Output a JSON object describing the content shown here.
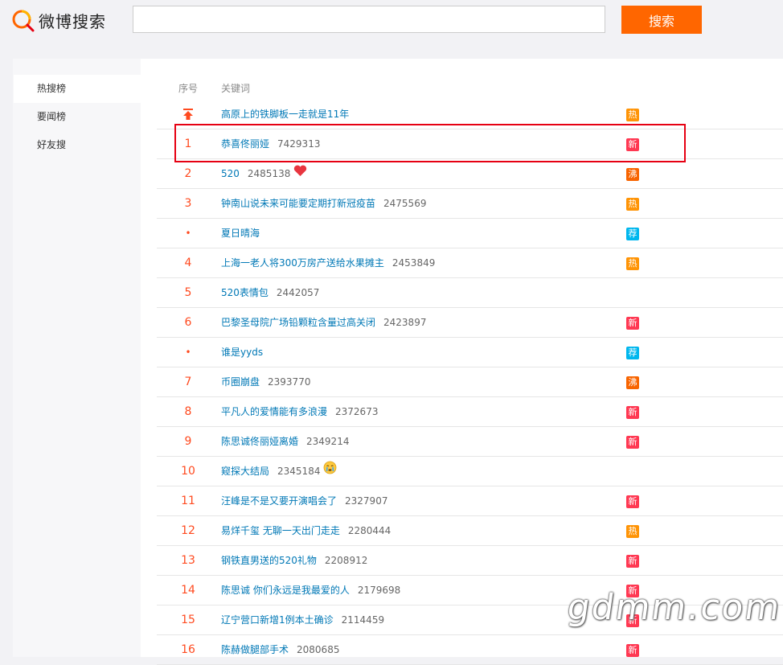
{
  "header": {
    "logo_text": "微博搜索",
    "search_placeholder": "",
    "search_button": "搜索"
  },
  "sidebar": {
    "items": [
      {
        "label": "热搜榜",
        "active": true
      },
      {
        "label": "要闻榜",
        "active": false
      },
      {
        "label": "好友搜",
        "active": false
      }
    ]
  },
  "table": {
    "col_rank": "序号",
    "col_keyword": "关键词",
    "rows": [
      {
        "rank": "",
        "rank_type": "top",
        "keyword": "高原上的铁脚板一走就是11年",
        "count": "",
        "emoji": "",
        "tag": "热",
        "tag_color": "#ff9406"
      },
      {
        "rank": "1",
        "rank_type": "num",
        "keyword": "恭喜佟丽娅",
        "count": "7429313",
        "emoji": "",
        "tag": "新",
        "tag_color": "#ff3852"
      },
      {
        "rank": "2",
        "rank_type": "num",
        "keyword": "520",
        "count": "2485138",
        "emoji": "heart",
        "tag": "沸",
        "tag_color": "#f86400"
      },
      {
        "rank": "3",
        "rank_type": "num",
        "keyword": "钟南山说未来可能要定期打新冠疫苗",
        "count": "2475569",
        "emoji": "",
        "tag": "热",
        "tag_color": "#ff9406"
      },
      {
        "rank": "•",
        "rank_type": "dot",
        "keyword": "夏日晴海",
        "count": "",
        "emoji": "",
        "tag": "荐",
        "tag_color": "#00b7ee"
      },
      {
        "rank": "4",
        "rank_type": "num",
        "keyword": "上海一老人将300万房产送给水果摊主",
        "count": "2453849",
        "emoji": "",
        "tag": "热",
        "tag_color": "#ff9406"
      },
      {
        "rank": "5",
        "rank_type": "num",
        "keyword": "520表情包",
        "count": "2442057",
        "emoji": "",
        "tag": "",
        "tag_color": ""
      },
      {
        "rank": "6",
        "rank_type": "num",
        "keyword": "巴黎圣母院广场铅颗粒含量过高关闭",
        "count": "2423897",
        "emoji": "",
        "tag": "新",
        "tag_color": "#ff3852"
      },
      {
        "rank": "•",
        "rank_type": "dot",
        "keyword": "谁是yyds",
        "count": "",
        "emoji": "",
        "tag": "荐",
        "tag_color": "#00b7ee"
      },
      {
        "rank": "7",
        "rank_type": "num",
        "keyword": "币圈崩盘",
        "count": "2393770",
        "emoji": "",
        "tag": "沸",
        "tag_color": "#f86400"
      },
      {
        "rank": "8",
        "rank_type": "num",
        "keyword": "平凡人的爱情能有多浪漫",
        "count": "2372673",
        "emoji": "",
        "tag": "新",
        "tag_color": "#ff3852"
      },
      {
        "rank": "9",
        "rank_type": "num",
        "keyword": "陈思诚佟丽娅离婚",
        "count": "2349214",
        "emoji": "",
        "tag": "新",
        "tag_color": "#ff3852"
      },
      {
        "rank": "10",
        "rank_type": "num",
        "keyword": "窥探大结局",
        "count": "2345184",
        "emoji": "cry",
        "tag": "",
        "tag_color": ""
      },
      {
        "rank": "11",
        "rank_type": "num",
        "keyword": "汪峰是不是又要开演唱会了",
        "count": "2327907",
        "emoji": "",
        "tag": "新",
        "tag_color": "#ff3852"
      },
      {
        "rank": "12",
        "rank_type": "num",
        "keyword": "易烊千玺 无聊一天出门走走",
        "count": "2280444",
        "emoji": "",
        "tag": "热",
        "tag_color": "#ff9406"
      },
      {
        "rank": "13",
        "rank_type": "num",
        "keyword": "钢铁直男送的520礼物",
        "count": "2208912",
        "emoji": "",
        "tag": "新",
        "tag_color": "#ff3852"
      },
      {
        "rank": "14",
        "rank_type": "num",
        "keyword": "陈思诚 你们永远是我最爱的人",
        "count": "2179698",
        "emoji": "",
        "tag": "新",
        "tag_color": "#ff3852"
      },
      {
        "rank": "15",
        "rank_type": "num",
        "keyword": "辽宁营口新增1例本土确诊",
        "count": "2114459",
        "emoji": "",
        "tag": "新",
        "tag_color": "#ff3852"
      },
      {
        "rank": "16",
        "rank_type": "num",
        "keyword": "陈赫做腿部手术",
        "count": "2080685",
        "emoji": "",
        "tag": "新",
        "tag_color": "#ff3852"
      }
    ]
  },
  "watermark": "gdmm.com"
}
